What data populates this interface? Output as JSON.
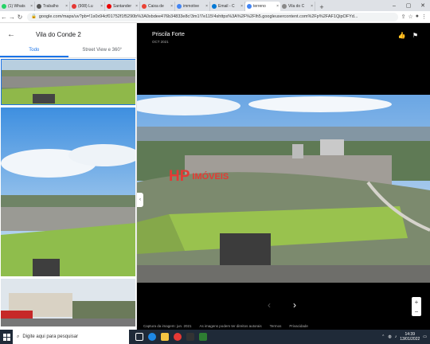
{
  "browser": {
    "tabs": [
      {
        "label": "(1) Whats",
        "color": "#25d366"
      },
      {
        "label": "Trabalho",
        "color": "#555555"
      },
      {
        "label": "(908) Lu",
        "color": "#e53935"
      },
      {
        "label": "Santander",
        "color": "#ec0000"
      },
      {
        "label": "Caixa de",
        "color": "#ea4335"
      },
      {
        "label": "immotive",
        "color": "#4285f4"
      },
      {
        "label": "Email - C",
        "color": "#0078d4"
      },
      {
        "label": "terreno",
        "color": "#4285f4",
        "active": true
      },
      {
        "label": "Vila do C",
        "color": "#888888"
      }
    ],
    "url": "google.com/maps/uv?pb=!1s0x94cf01752f1f5290b%3A0xbdee476b34833e8c!3m1!7e115!4shttps%3A%2F%2Flh5.googleusercontent.com%2Fp%2FAF1QipOFYd..."
  },
  "left_panel": {
    "title": "Vila do Conde 2",
    "tabs": [
      "Todo",
      "Street View e 360°"
    ]
  },
  "viewer": {
    "author": "Priscila Forte",
    "date": "OCT 2021",
    "watermark_hp": "HP",
    "watermark_brand": "IMÓVEIS",
    "footer": [
      "Captura da imagem: jun. 2021",
      "As imagens podem ter direitos autorais",
      "Termos",
      "Privacidade"
    ]
  },
  "taskbar": {
    "search_placeholder": "Digite aqui para pesquisar",
    "time": "14:39",
    "date": "13/01/2022"
  }
}
